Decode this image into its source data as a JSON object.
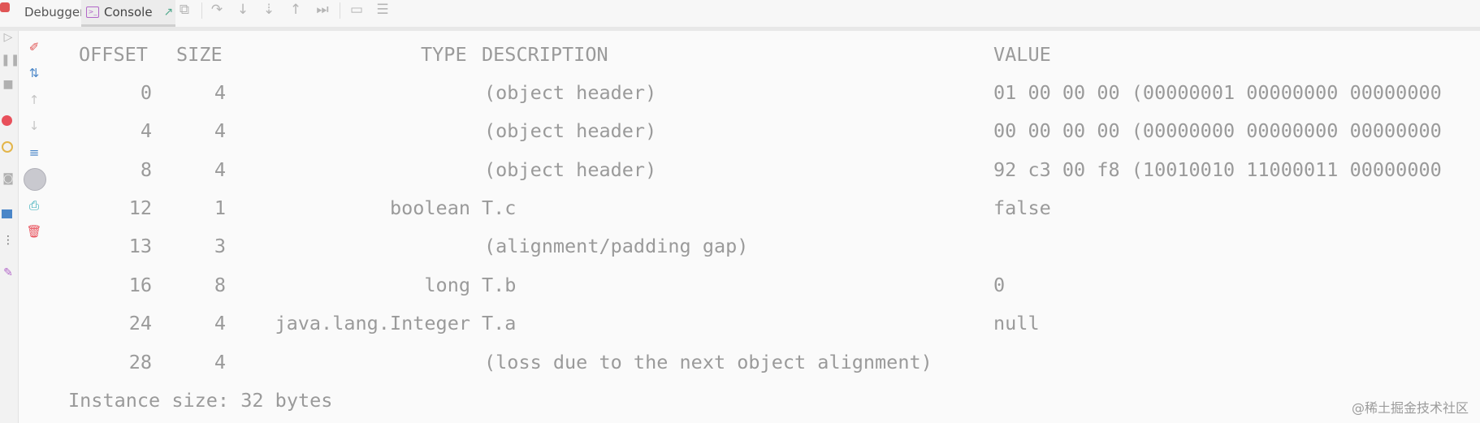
{
  "tabs": {
    "debugger": "Debugger",
    "console": "Console"
  },
  "table": {
    "headers": {
      "offset": "OFFSET",
      "size": "SIZE",
      "type": "TYPE",
      "description": "DESCRIPTION",
      "value": "VALUE"
    },
    "rows": [
      {
        "offset": "0",
        "size": "4",
        "type": "",
        "description": "(object header)",
        "value": "01 00 00 00 (00000001 00000000 00000000"
      },
      {
        "offset": "4",
        "size": "4",
        "type": "",
        "description": "(object header)",
        "value": "00 00 00 00 (00000000 00000000 00000000"
      },
      {
        "offset": "8",
        "size": "4",
        "type": "",
        "description": "(object header)",
        "value": "92 c3 00 f8 (10010010 11000011 00000000"
      },
      {
        "offset": "12",
        "size": "1",
        "type": "boolean",
        "description": "T.c",
        "value": "false"
      },
      {
        "offset": "13",
        "size": "3",
        "type": "",
        "description": "(alignment/padding gap)",
        "value": ""
      },
      {
        "offset": "16",
        "size": "8",
        "type": "long",
        "description": "T.b",
        "value": "0"
      },
      {
        "offset": "24",
        "size": "4",
        "type": "java.lang.Integer",
        "description": "T.a",
        "value": "null"
      },
      {
        "offset": "28",
        "size": "4",
        "type": "",
        "description": "(loss due to the next object alignment)",
        "value": ""
      }
    ]
  },
  "footer": "Instance size: 32 bytes",
  "watermark": "@稀土掘金技术社区",
  "icons": {
    "toolbar": [
      "restore-layout-icon",
      "step-over-icon",
      "step-into-icon",
      "force-step-into-icon",
      "step-out-icon",
      "run-to-cursor-icon",
      "evaluate-icon",
      "trace-icon"
    ],
    "gutter": [
      "clear-icon",
      "sort-icon",
      "up-icon",
      "down-icon",
      "soft-wrap-icon",
      "settings-icon",
      "print-icon",
      "delete-icon"
    ]
  },
  "colors": {
    "accent_red": "#e05555",
    "accent_blue": "#4a86c8",
    "accent_purple": "#b267c9",
    "accent_green": "#4fa88c"
  }
}
